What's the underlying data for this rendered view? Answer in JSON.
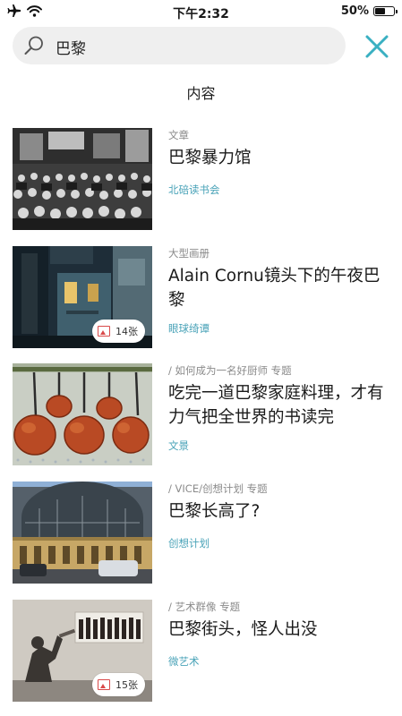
{
  "status_bar": {
    "time": "下午2:32",
    "battery": "50%",
    "battery_level": 0.5
  },
  "search": {
    "query": "巴黎"
  },
  "section_title": "内容",
  "items": [
    {
      "category": "文章",
      "title": "巴黎暴力馆",
      "source": "北碚读书会"
    },
    {
      "category": "大型画册",
      "title": "Alain Cornu镜头下的午夜巴黎",
      "source": "眼球绮谭",
      "photo_count": "14张"
    },
    {
      "category": "/ 如何成为一名好厨师 专题",
      "title": "吃完一道巴黎家庭料理，才有力气把全世界的书读完",
      "source": "文景"
    },
    {
      "category": "/ VICE/创想计划 专题",
      "title": "巴黎长高了?",
      "source": "创想计划"
    },
    {
      "category": "/ 艺术群像 专题",
      "title": "巴黎街头，怪人出没",
      "source": "微艺术",
      "photo_count": "15张"
    }
  ],
  "colors": {
    "accent": "#3ab0c2",
    "source_link": "#4aa3b8",
    "badge_icon": "#d94a4a"
  },
  "icons": [
    "airplane-icon",
    "wifi-icon",
    "battery-icon",
    "search-icon",
    "close-icon",
    "photo-icon"
  ]
}
